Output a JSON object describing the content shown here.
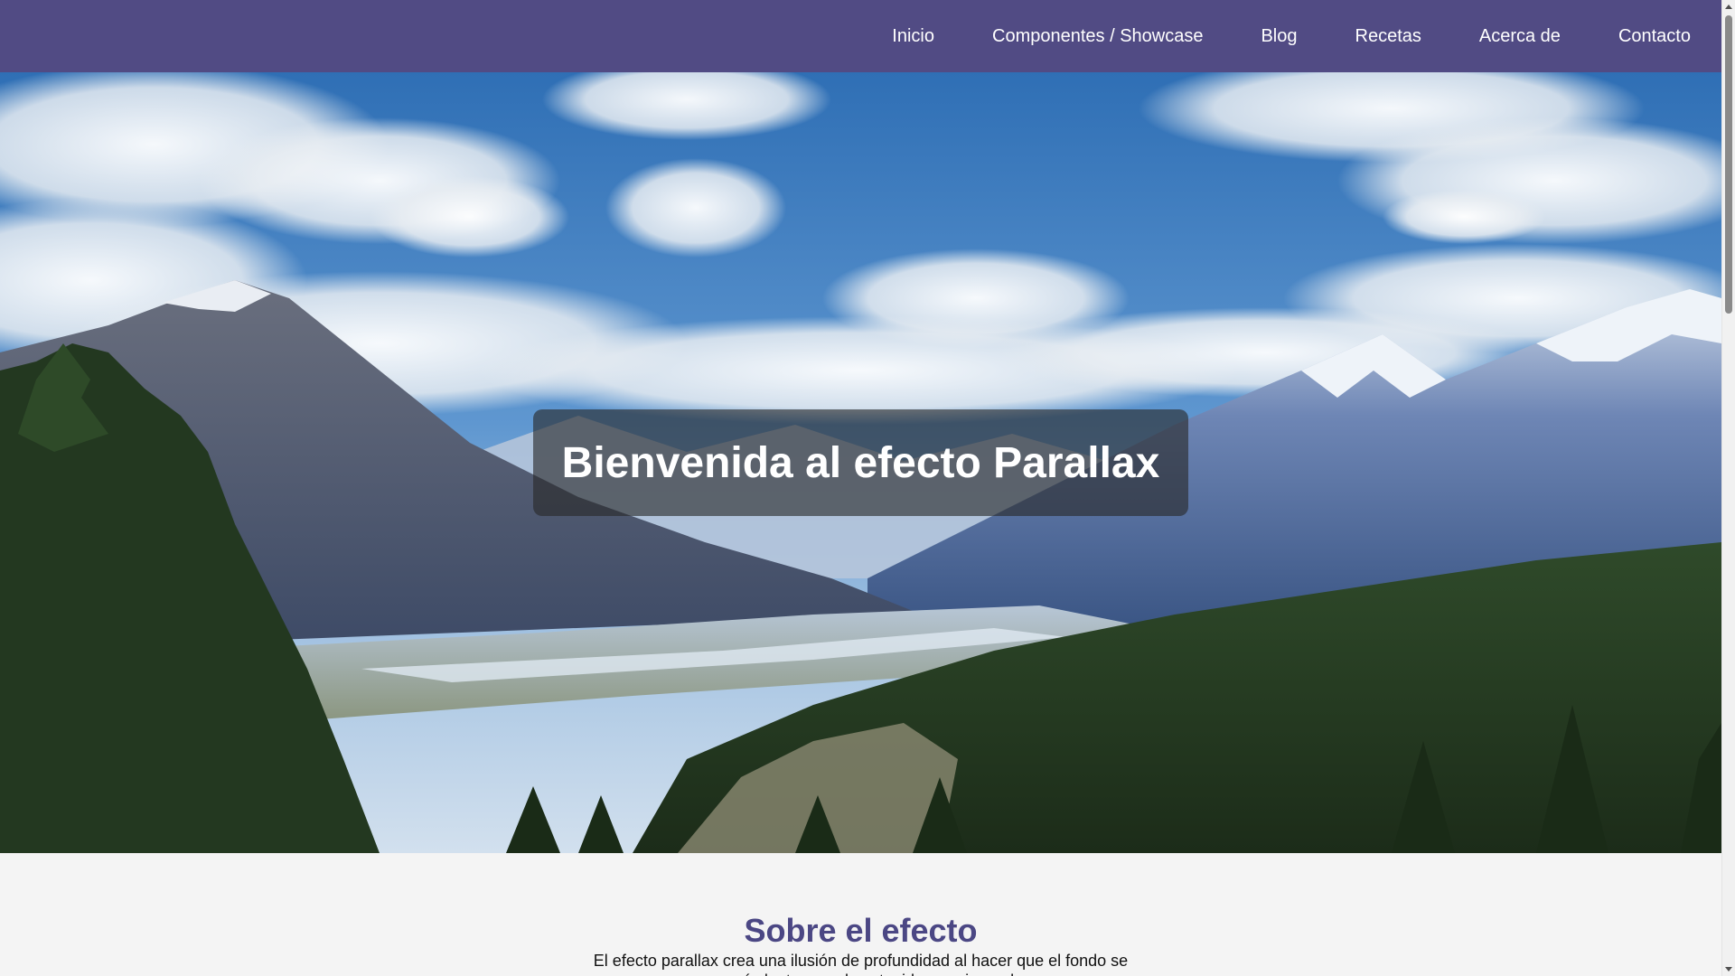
{
  "nav": {
    "items": [
      {
        "label": "Inicio"
      },
      {
        "label": "Componentes / Showcase"
      },
      {
        "label": "Blog"
      },
      {
        "label": "Recetas"
      },
      {
        "label": "Acerca de"
      },
      {
        "label": "Contacto"
      }
    ]
  },
  "hero": {
    "title": "Bienvenida al efecto Parallax",
    "image": "mountain-valley-landscape"
  },
  "about": {
    "title": "Sobre el efecto",
    "text": "El efecto parallax crea una ilusión de profundidad al hacer que el fondo se mueva más lento que el contenido en primer plano."
  },
  "colors": {
    "navbar": "#514b84",
    "accent_title": "#4b4784",
    "page_bg": "#f4f4f4"
  }
}
